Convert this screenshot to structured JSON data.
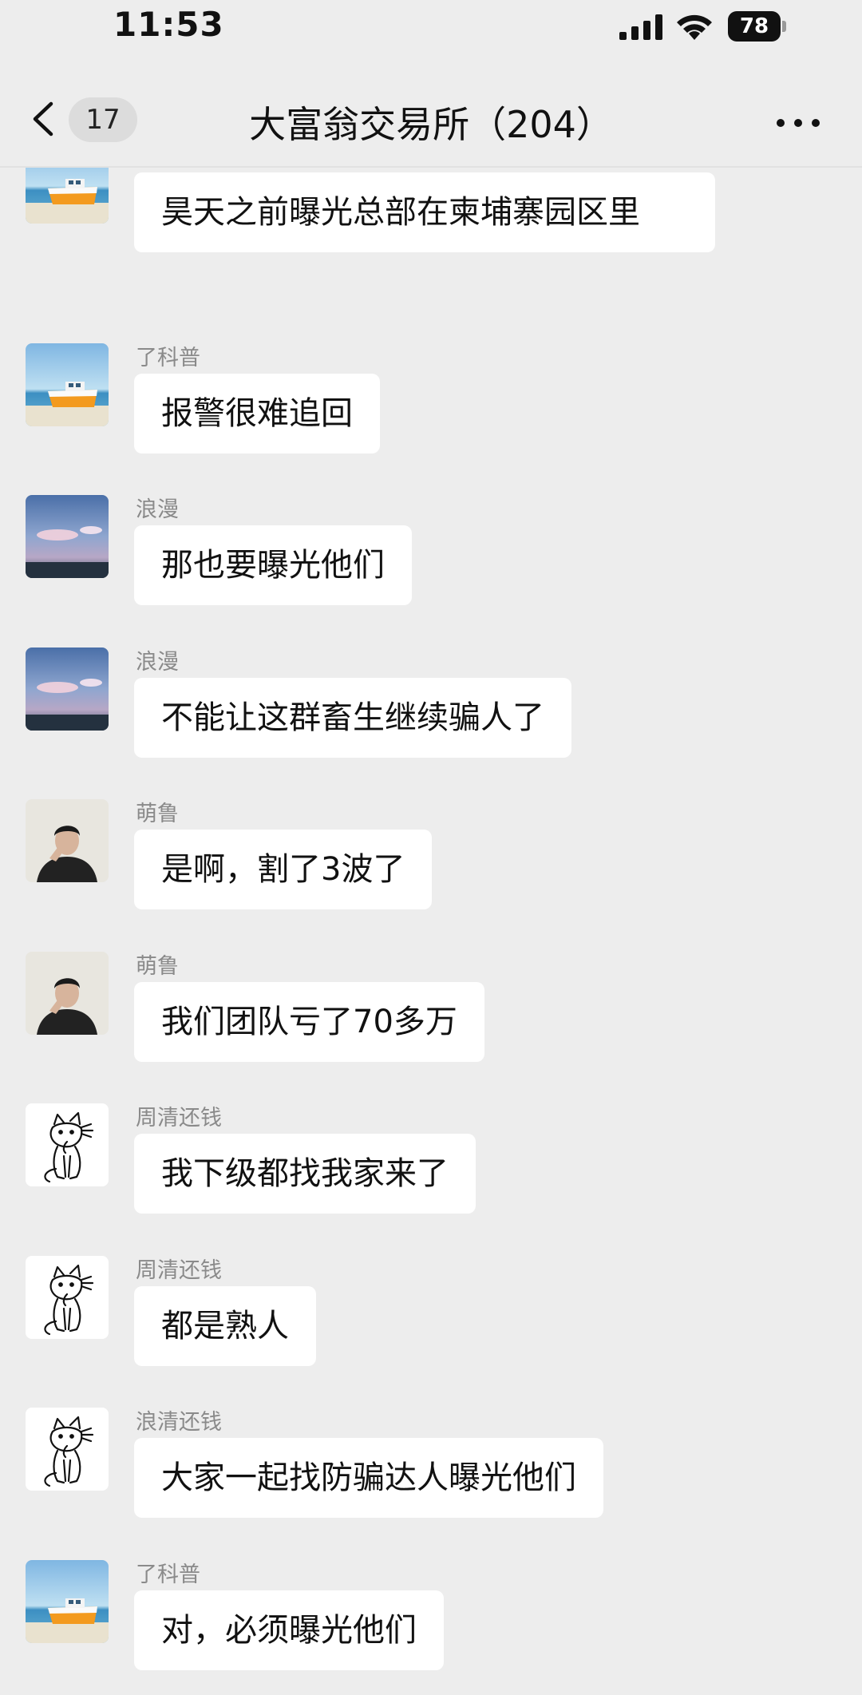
{
  "status_bar": {
    "time": "11:53",
    "battery": "78"
  },
  "header": {
    "unread_count": "17",
    "title": "大富翁交易所（204）"
  },
  "messages": [
    {
      "sender": "",
      "text": "昊天之前曝光总部在柬埔寨园区里",
      "avatar": "boat-avatar"
    },
    {
      "sender": "了科普",
      "text": "报警很难追回",
      "avatar": "boat-avatar"
    },
    {
      "sender": "浪漫",
      "text": "那也要曝光他们",
      "avatar": "sky-avatar"
    },
    {
      "sender": "浪漫",
      "text": "不能让这群畜生继续骗人了",
      "avatar": "sky-avatar"
    },
    {
      "sender": "萌鲁",
      "text": "是啊，割了3波了",
      "avatar": "person-avatar"
    },
    {
      "sender": "萌鲁",
      "text": "我们团队亏了70多万",
      "avatar": "person-avatar"
    },
    {
      "sender": "周清还钱",
      "text": "我下级都找我家来了",
      "avatar": "cat-avatar"
    },
    {
      "sender": "周清还钱",
      "text": "都是熟人",
      "avatar": "cat-avatar"
    },
    {
      "sender": "浪清还钱",
      "text": "大家一起找防骗达人曝光他们",
      "avatar": "cat-avatar"
    },
    {
      "sender": "了科普",
      "text": "对，必须曝光他们",
      "avatar": "boat-avatar"
    }
  ]
}
